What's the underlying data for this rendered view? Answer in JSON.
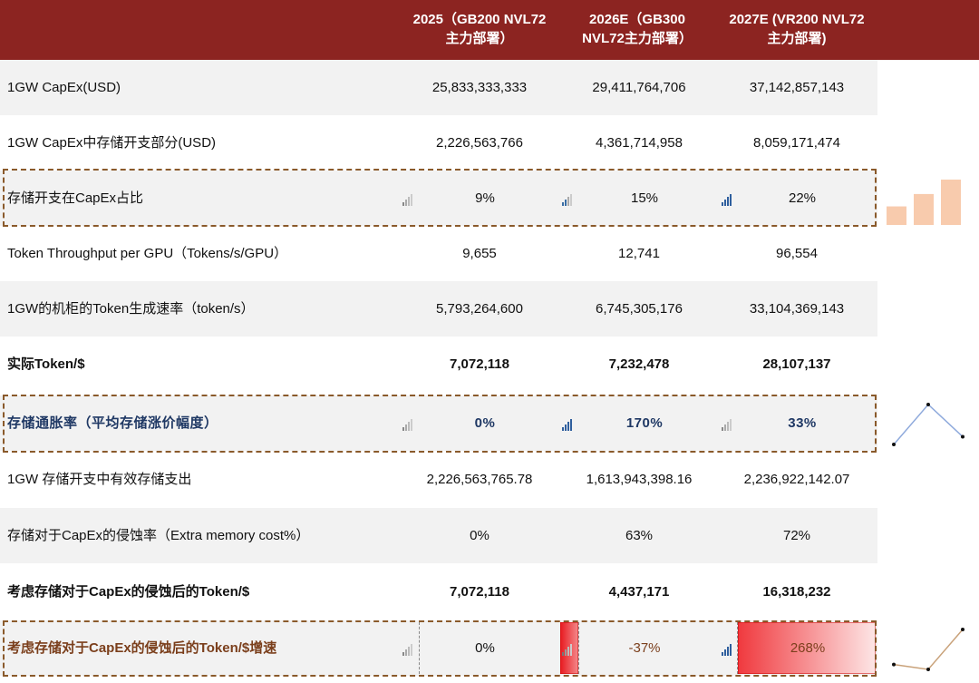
{
  "header": {
    "col1": "2025（GB200 NVL72\n主力部署）",
    "col2": "2026E（GB300\nNVL72主力部署）",
    "col3": "2027E (VR200 NVL72\n主力部署)"
  },
  "rows": [
    {
      "label": "1GW CapEx(USD)",
      "v1": "25,833,333,333",
      "v2": "29,411,764,706",
      "v3": "37,142,857,143"
    },
    {
      "label": "1GW CapEx中存储开支部分(USD)",
      "v1": "2,226,563,766",
      "v2": "4,361,714,958",
      "v3": "8,059,171,474"
    },
    {
      "label": "存储开支在CapEx占比",
      "v1": "9%",
      "v2": "15%",
      "v3": "22%"
    },
    {
      "label": "Token Throughput per GPU（Tokens/s/GPU）",
      "v1": "9,655",
      "v2": "12,741",
      "v3": "96,554"
    },
    {
      "label": "1GW的机柜的Token生成速率（token/s）",
      "v1": "5,793,264,600",
      "v2": "6,745,305,176",
      "v3": "33,104,369,143"
    },
    {
      "label": "实际Token/$",
      "v1": "7,072,118",
      "v2": "7,232,478",
      "v3": "28,107,137"
    },
    {
      "label": "存储通胀率（平均存储涨价幅度）",
      "v1": "0%",
      "v2": "170%",
      "v3": "33%"
    },
    {
      "label": "1GW 存储开支中有效存储支出",
      "v1": "2,226,563,765.78",
      "v2": "1,613,943,398.16",
      "v3": "2,236,922,142.07"
    },
    {
      "label": "存储对于CapEx的侵蚀率（Extra memory cost%）",
      "v1": "0%",
      "v2": "63%",
      "v3": "72%"
    },
    {
      "label": "考虑存储对于CapEx的侵蚀后的Token/$",
      "v1": "7,072,118",
      "v2": "4,437,171",
      "v3": "16,318,232"
    },
    {
      "label": "考虑存储对于CapEx的侵蚀后的Token/$增速",
      "v1": "0%",
      "v2": "-37%",
      "v3": "268%"
    }
  ],
  "chart_data": [
    {
      "type": "bar",
      "categories": [
        "2025",
        "2026E",
        "2027E"
      ],
      "values": [
        9,
        15,
        22
      ],
      "color": "#f8cbad"
    },
    {
      "type": "line",
      "categories": [
        "2025",
        "2026E",
        "2027E"
      ],
      "values": [
        0,
        170,
        33
      ],
      "color": "#8faadc"
    },
    {
      "type": "line",
      "categories": [
        "2025",
        "2026E",
        "2027E"
      ],
      "values": [
        0,
        -37,
        268
      ],
      "color": "#c9a27a"
    }
  ],
  "colors": {
    "header": "#8c2421",
    "blue_text": "#1f3864",
    "brown_text": "#7b3f1c",
    "red_fill": "#f4565a",
    "dash": "#8a5a2b"
  }
}
